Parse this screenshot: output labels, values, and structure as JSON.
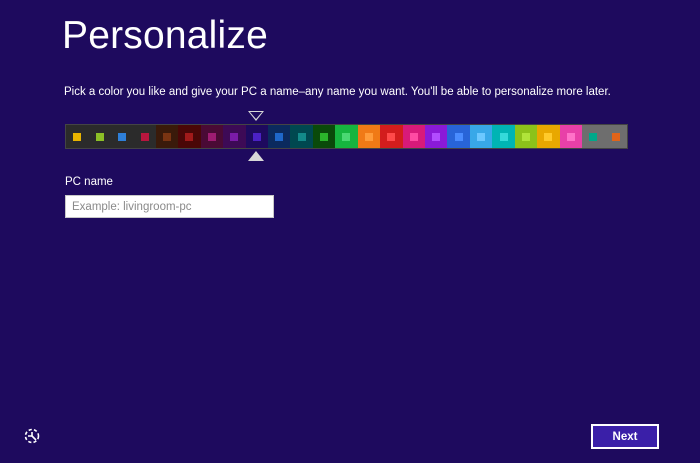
{
  "header": {
    "title": "Personalize",
    "subtitle": "Pick a color you like and give your PC a name–any name you want. You'll be able to personalize more later."
  },
  "palette": {
    "selected_index": 8,
    "swatches": [
      {
        "bg": "#2b2b2b",
        "chip": "#e8b400"
      },
      {
        "bg": "#2b2b2b",
        "chip": "#8cbf26"
      },
      {
        "bg": "#2b2b2b",
        "chip": "#2e7fd8"
      },
      {
        "bg": "#2b2b2b",
        "chip": "#b7163e"
      },
      {
        "bg": "#3a1a0a",
        "chip": "#7a3412"
      },
      {
        "bg": "#4a0707",
        "chip": "#a11a1a"
      },
      {
        "bg": "#4a0a35",
        "chip": "#9e1c72"
      },
      {
        "bg": "#3d0a56",
        "chip": "#7b1ca8"
      },
      {
        "bg": "#1e0a5e",
        "chip": "#4b21c4"
      },
      {
        "bg": "#0b2a5e",
        "chip": "#1f67c9"
      },
      {
        "bg": "#004850",
        "chip": "#138a8a"
      },
      {
        "bg": "#0a4a0a",
        "chip": "#2bb52b"
      },
      {
        "bg": "#16b53f",
        "chip": "#4ad872"
      },
      {
        "bg": "#f07a16",
        "chip": "#ff9c3a"
      },
      {
        "bg": "#d31d1d",
        "chip": "#ff4a4a"
      },
      {
        "bg": "#d81a7a",
        "chip": "#ff4aa3"
      },
      {
        "bg": "#8a1ad8",
        "chip": "#b24cff"
      },
      {
        "bg": "#2864d8",
        "chip": "#4a8cff"
      },
      {
        "bg": "#38a8e8",
        "chip": "#6cc8ff"
      },
      {
        "bg": "#00b4b4",
        "chip": "#34dada"
      },
      {
        "bg": "#8cc21a",
        "chip": "#b0e43a"
      },
      {
        "bg": "#e8a800",
        "chip": "#ffca2a"
      },
      {
        "bg": "#e840a8",
        "chip": "#ff72c8"
      },
      {
        "bg": "#6e6e6e",
        "chip": "#00a88a"
      },
      {
        "bg": "#6e6e6e",
        "chip": "#e0641a"
      }
    ]
  },
  "pc_name": {
    "label": "PC name",
    "value": "",
    "placeholder": "Example: livingroom-pc"
  },
  "footer": {
    "ease_of_access_icon": "ease-of-access-icon",
    "next_label": "Next"
  }
}
